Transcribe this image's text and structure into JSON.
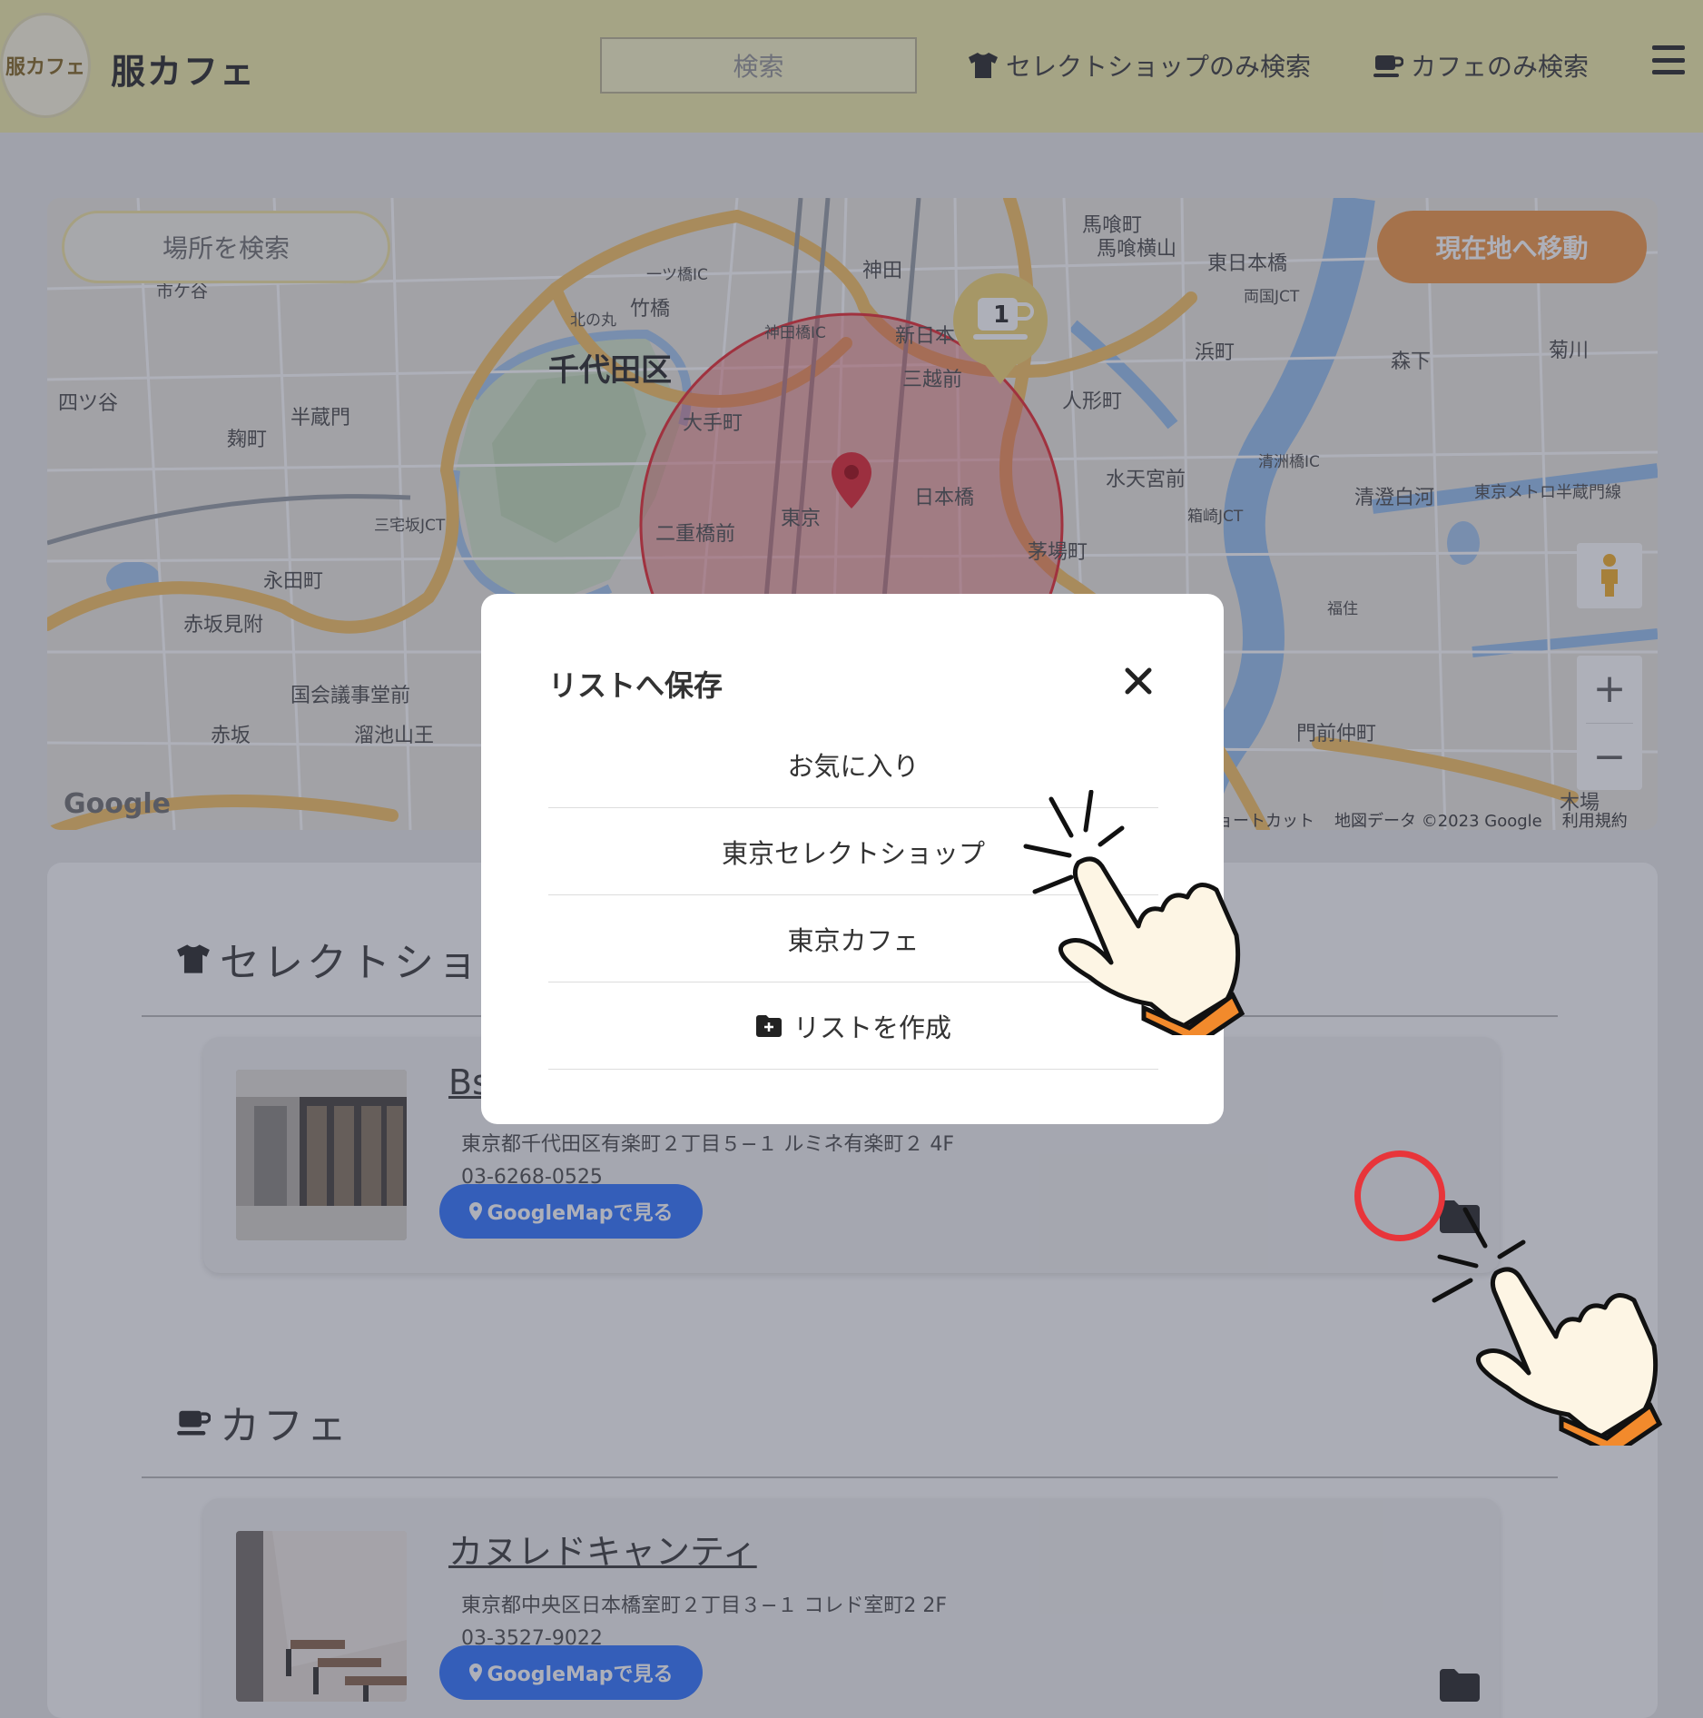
{
  "header": {
    "brand": "服カフェ",
    "logo_text": "服カフェ",
    "search_placeholder": "検索",
    "nav_shop": "セレクトショップのみ検索",
    "nav_cafe": "カフェのみ検索"
  },
  "map": {
    "place_search_placeholder": "場所を検索",
    "current_location_button": "現在地へ移動",
    "zoom_in": "+",
    "zoom_out": "−",
    "google_logo": "Google",
    "attribution": [
      "ショートカット",
      "地図データ ©2023 Google",
      "利用規約"
    ],
    "marker_count": "1",
    "labels": {
      "chiyoda": "千代田区",
      "tokyo": "東京",
      "otemachi": "大手町",
      "nihonbashi": "日本橋",
      "mitsukoshimae": "三越前",
      "nijubashimae": "二重橋前",
      "yotsuya": "四ツ谷",
      "hanzomon": "半蔵門",
      "kojimachi": "麹町",
      "nagatacho": "永田町",
      "akasakamitsuke": "赤坂見附",
      "kokkaigijidomae": "国会議事堂前",
      "akasaka": "赤坂",
      "tameikesanno": "溜池山王",
      "kanda": "神田",
      "bakurocho": "馬喰町",
      "bakuroyokoyama": "馬喰横山",
      "higashinihonbashi": "東日本橋",
      "hamacho": "浜町",
      "ningyocho": "人形町",
      "suitengumae": "水天宮前",
      "kayabacho": "茅場町",
      "morishita": "森下",
      "kikukawa": "菊川",
      "kiyosumishirakawa": "清澄白河",
      "monzennakacho": "門前仲町",
      "kiba": "木場",
      "takebashi": "竹橋",
      "kitanomaru": "北の丸",
      "hitotsubashi_ic": "一ツ橋IC",
      "kandabashi_ic": "神田橋IC",
      "miyakezaka_jct": "三宅坂JCT",
      "ryogoku_jct": "両国JCT",
      "hakozaki_jct": "箱崎JCT",
      "kiyosubashi_ic": "清洲橋IC",
      "fukuzumi": "福住",
      "shinnihon": "新日本",
      "hanzomon_line": "東京メトロ半蔵門線",
      "ichigaya": "市ケ谷"
    }
  },
  "modal": {
    "title": "リストへ保存",
    "items": [
      "お気に入り",
      "東京セレクトショップ",
      "東京カフェ"
    ],
    "create_list": "リストを作成"
  },
  "sections": {
    "shop_heading": "セレクトショップ",
    "cafe_heading": "カフェ"
  },
  "shop_card": {
    "name": "Bs",
    "address": "東京都千代田区有楽町２丁目５−１ ルミネ有楽町２ 4F",
    "tel": "03-6268-0525",
    "map_button": "GoogleMapで見る"
  },
  "cafe_card": {
    "name": "カヌレドキャンティ",
    "address": "東京都中央区日本橋室町２丁目３−１ コレド室町2 2F",
    "tel": "03-3527-9022",
    "map_button": "GoogleMapで見る"
  },
  "colors": {
    "header_bg": "#f1ecac",
    "accent_orange": "#f19b4e",
    "map_button_blue": "#3a7bff",
    "radius_red": "#e8353a"
  }
}
